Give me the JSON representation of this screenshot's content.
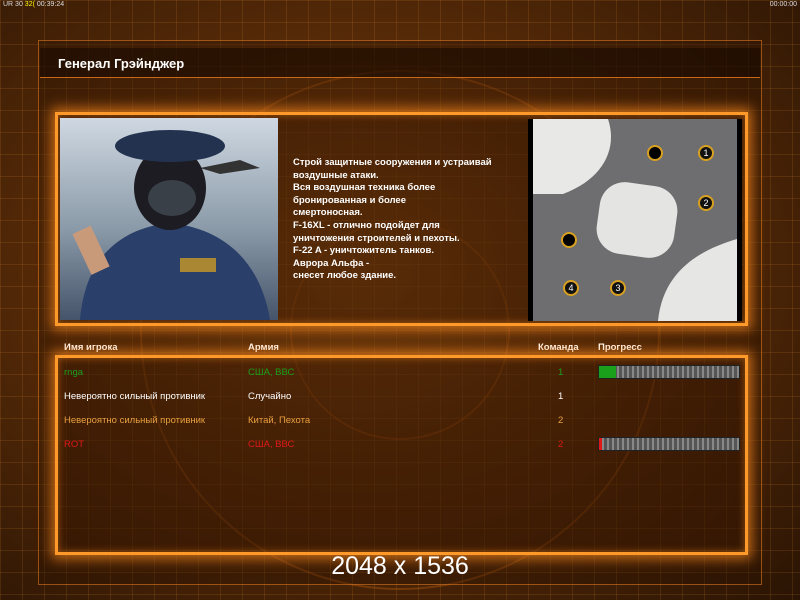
{
  "status_bar": {
    "left_a": "UR 30",
    "left_b": "32(",
    "left_c": "00:39:24",
    "right": "00:00:00"
  },
  "title": "Генерал Грэйнджер",
  "description": "Строй защитные сооружения и устраивай\n воздушные атаки.\nВся воздушная техника более\n бронированная и более\nсмертоносная.\nF-16XL - отлично подойдет для\n уничтожения строителей и пехоты.\nF-22 A - уничтожитель танков.\nАврора Альфа -\nснесет любое здание.",
  "map": {
    "start_positions": [
      "1",
      "2",
      "3",
      "4"
    ]
  },
  "table": {
    "headers": {
      "player": "Имя игрока",
      "army": "Армия",
      "team": "Команда",
      "progress": "Прогресс"
    },
    "rows": [
      {
        "name": "rnga",
        "army": "США, ВВС",
        "team": "1",
        "color": "#1aa01a",
        "progress": 12
      },
      {
        "name": "Невероятно сильный противник",
        "army": "Случайно",
        "team": "1",
        "color": "#ffffff",
        "progress": null
      },
      {
        "name": "Невероятно сильный противник",
        "army": "Китай, Пехота",
        "team": "2",
        "color": "#e8a040",
        "progress": null
      },
      {
        "name": "ROT",
        "army": "США, ВВС",
        "team": "2",
        "color": "#e01818",
        "progress": 2
      }
    ]
  },
  "resolution": "2048 x 1536"
}
